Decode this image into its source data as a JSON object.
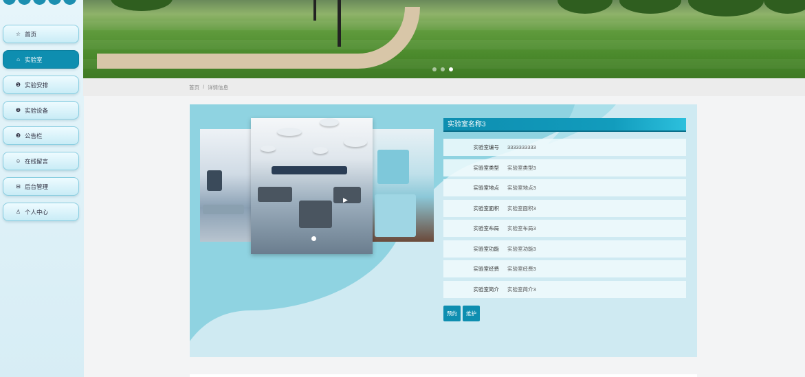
{
  "sidebar": {
    "items": [
      {
        "icon": "home-icon",
        "glyph": "☆",
        "label": "首页",
        "active": false
      },
      {
        "icon": "lab-icon",
        "glyph": "⌂",
        "label": "实验室",
        "active": true
      },
      {
        "icon": "schedule-icon",
        "glyph": "❶",
        "label": "实验安排",
        "active": false
      },
      {
        "icon": "equipment-icon",
        "glyph": "❷",
        "label": "实验设备",
        "active": false
      },
      {
        "icon": "notice-icon",
        "glyph": "❸",
        "label": "公告栏",
        "active": false
      },
      {
        "icon": "message-icon",
        "glyph": "☺",
        "label": "在线留言",
        "active": false
      },
      {
        "icon": "admin-icon",
        "glyph": "⊟",
        "label": "后台管理",
        "active": false
      },
      {
        "icon": "user-icon",
        "glyph": "♙",
        "label": "个人中心",
        "active": false
      }
    ]
  },
  "banner": {
    "slide_count": 3,
    "active_slide": 3
  },
  "breadcrumb": {
    "home": "首页",
    "separator": "/",
    "current": "详情信息"
  },
  "detail": {
    "title": "实验室名称3",
    "fields": [
      {
        "label": "实验室编号",
        "value": "3333333333"
      },
      {
        "label": "实验室类型",
        "value": "实验室类型3"
      },
      {
        "label": "实验室地点",
        "value": "实验室地点3"
      },
      {
        "label": "实验室面积",
        "value": "实验室面积3"
      },
      {
        "label": "实验室布局",
        "value": "实验室布局3"
      },
      {
        "label": "实验室功能",
        "value": "实验室功能3"
      },
      {
        "label": "实验室经费",
        "value": "实验室经费3"
      },
      {
        "label": "实验室简介",
        "value": "实验室简介3"
      }
    ],
    "buttons": {
      "reserve": "预约",
      "maintain": "维护"
    }
  },
  "colors": {
    "accent": "#0e8eb0",
    "card_bg": "#cfeaf2",
    "sidebar_bg": "#e6f5fa"
  }
}
